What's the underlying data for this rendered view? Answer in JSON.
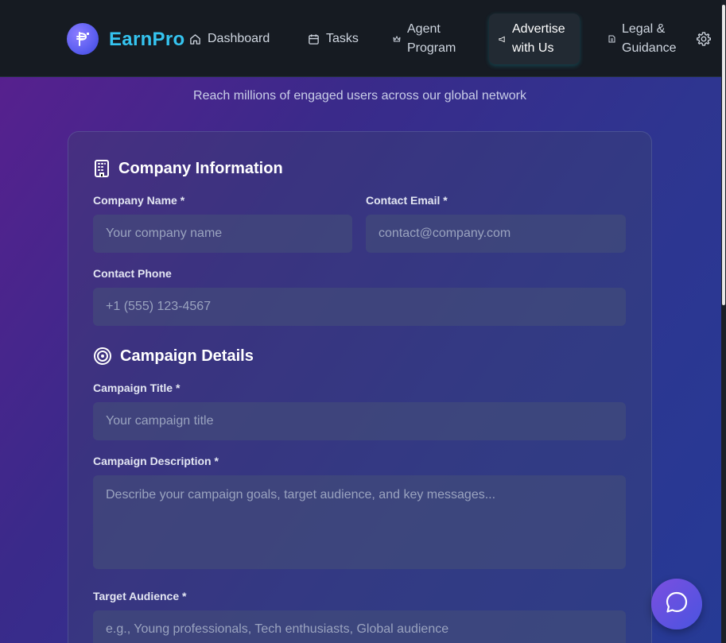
{
  "brand": {
    "name": "EarnPro"
  },
  "nav": {
    "dashboard": "Dashboard",
    "tasks": "Tasks",
    "agent_line1": "Agent",
    "agent_line2": "Program",
    "advertise_line1": "Advertise",
    "advertise_line2": "with Us",
    "legal_line1": "Legal &",
    "legal_line2": "Guidance"
  },
  "hero": {
    "subtitle": "Reach millions of engaged users across our global network"
  },
  "company": {
    "title": "Company Information",
    "name_label": "Company Name *",
    "name_placeholder": "Your company name",
    "email_label": "Contact Email *",
    "email_placeholder": "contact@company.com",
    "phone_label": "Contact Phone",
    "phone_placeholder": "+1 (555) 123-4567"
  },
  "campaign": {
    "title": "Campaign Details",
    "title_label": "Campaign Title *",
    "title_placeholder": "Your campaign title",
    "desc_label": "Campaign Description *",
    "desc_placeholder": "Describe your campaign goals, target audience, and key messages...",
    "audience_label": "Target Audience *",
    "audience_placeholder": "e.g., Young professionals, Tech enthusiasts, Global audience"
  },
  "icons": {
    "logo": "logo-icon",
    "dashboard": "home-icon",
    "tasks": "calendar-icon",
    "agent": "crown-icon",
    "advertise": "megaphone-icon",
    "legal": "document-icon",
    "settings": "gear-icon",
    "company": "building-icon",
    "campaign": "target-icon",
    "chat": "chat-bubble-icon"
  },
  "colors": {
    "accent": "#35c4f0",
    "topbar": "#161b22"
  }
}
